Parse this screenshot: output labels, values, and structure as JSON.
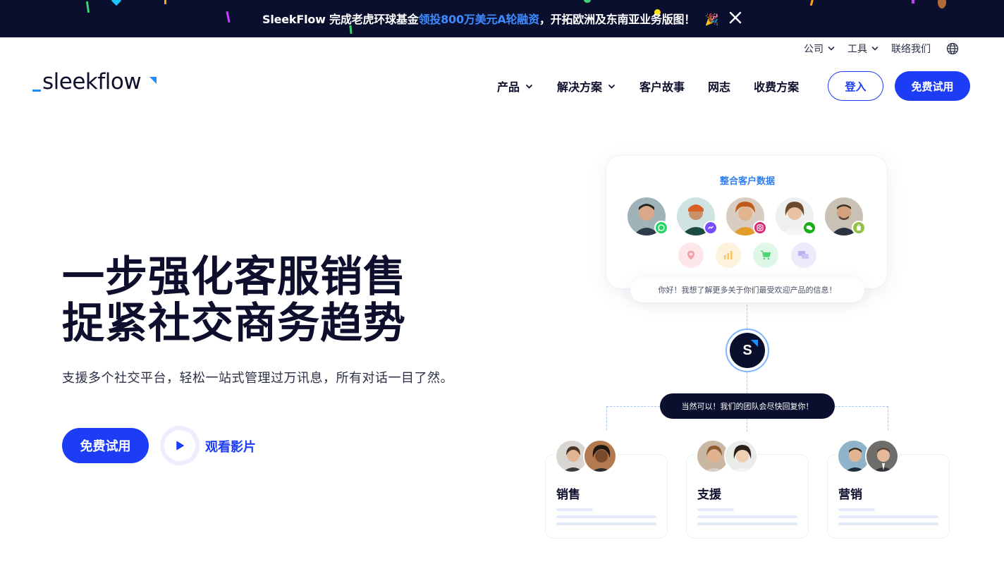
{
  "announcement": {
    "prefix": "SleekFlow 完成老虎环球基金",
    "highlight": "领投800万美元A轮融资",
    "suffix": "，开拓欧洲及东南亚业务版图！",
    "emoji": "🎉",
    "close_icon": "close-icon",
    "background": "#0b0f2e",
    "highlight_color": "#3d8bff"
  },
  "utility_nav": {
    "items": [
      {
        "label": "公司",
        "has_dropdown": true
      },
      {
        "label": "工具",
        "has_dropdown": true
      },
      {
        "label": "联络我们",
        "has_dropdown": false
      }
    ],
    "language_icon": "globe-icon"
  },
  "brand": {
    "logo_text": "sleekflow",
    "accent": "#1a8fff"
  },
  "main_nav": {
    "items": [
      {
        "label": "产品",
        "has_dropdown": true
      },
      {
        "label": "解决方案",
        "has_dropdown": true
      },
      {
        "label": "客户故事",
        "has_dropdown": false
      },
      {
        "label": "网志",
        "has_dropdown": false
      },
      {
        "label": "收费方案",
        "has_dropdown": false
      }
    ],
    "login_label": "登入",
    "trial_label": "免费试用",
    "primary_color": "#1c3df5"
  },
  "hero": {
    "title_line1": "一步强化客服销售",
    "title_line2": "捉紧社交商务趋势",
    "subtitle": "支援多个社交平台，轻松一站式管理过万讯息，所有对话一目了然。",
    "cta_label": "免费试用",
    "video_label": "观看影片",
    "play_icon": "play-icon"
  },
  "illustration": {
    "card_title": "整合客户数据",
    "customer_channels": [
      "whatsapp-icon",
      "messenger-icon",
      "instagram-icon",
      "wechat-icon",
      "shopify-icon"
    ],
    "data_icons": [
      "location-icon",
      "analytics-icon",
      "cart-icon",
      "chat-icon"
    ],
    "customer_message": "你好！我想了解更多关于你们最受欢迎产品的信息！",
    "hub_letter": "S",
    "reply_message": "当然可以！我们的团队会尽快回复你！",
    "teams": [
      {
        "label": "销售"
      },
      {
        "label": "支援"
      },
      {
        "label": "营销"
      }
    ]
  }
}
